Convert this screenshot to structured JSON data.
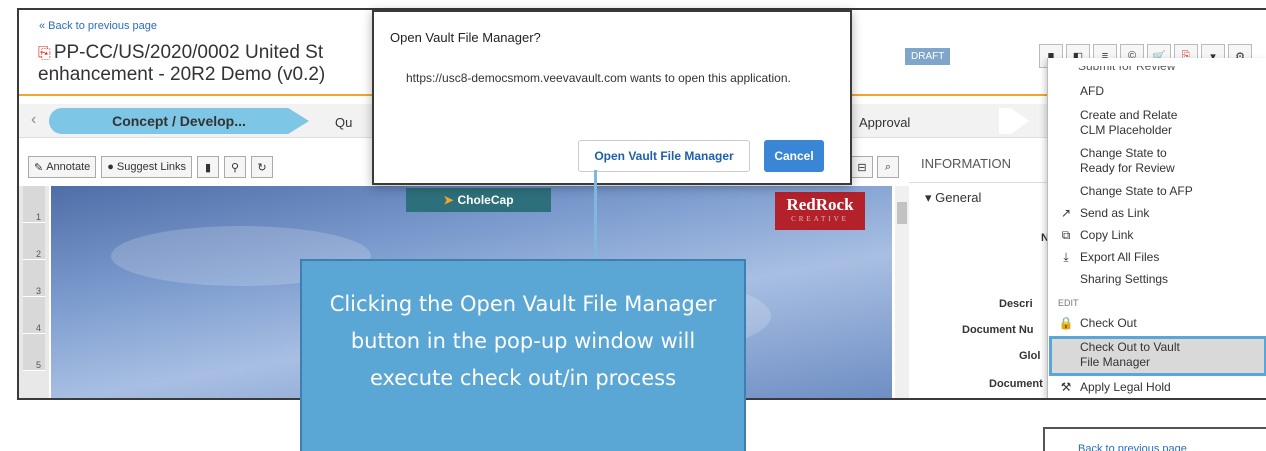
{
  "page": {
    "back_link": "« Back to previous page",
    "title_line1": "PP-CC/US/2020/0002 United St",
    "title_line2": "enhancement - 20R2 Demo (v0.2)",
    "status_badge": "DRAFT"
  },
  "lifecycle": {
    "active_step": "Concept / Develop...",
    "step2": "Qu",
    "step_approval": "Approval"
  },
  "view_toolbar": {
    "annotate": "Annotate",
    "suggest_links": "Suggest Links"
  },
  "info_panel": {
    "header": "INFORMATION",
    "general": "General",
    "labels": [
      "N",
      "Descri",
      "Document Nu",
      "Glol",
      "Document"
    ]
  },
  "document": {
    "page_numbers": [
      "1",
      "2",
      "3",
      "4",
      "5"
    ],
    "logo_left": "CholeCap",
    "logo_right": "RedRock",
    "logo_right_sub": "CREATIVE"
  },
  "dialog": {
    "title": "Open Vault File Manager?",
    "message": "https://usc8-democsmom.veevavault.com wants to open this application.",
    "open_button": "Open Vault File Manager",
    "cancel_button": "Cancel"
  },
  "callout": {
    "text": "Clicking the Open Vault File Manager button in the pop-up window will execute check out/in process"
  },
  "menu": {
    "cut_item": "Submit for Review",
    "items": [
      {
        "label": "AFD",
        "icon": ""
      },
      {
        "label": "Create and Relate CLM Placeholder",
        "icon": ""
      },
      {
        "label": "Change State to Ready for Review",
        "icon": ""
      },
      {
        "label": "Change State to AFP",
        "icon": ""
      },
      {
        "label": "Send as Link",
        "icon": "share-icon"
      },
      {
        "label": "Copy Link",
        "icon": "copy-icon"
      },
      {
        "label": "Export All Files",
        "icon": "download-icon"
      },
      {
        "label": "Sharing Settings",
        "icon": ""
      }
    ],
    "section_edit": "EDIT",
    "edit_items": [
      {
        "label": "Check Out",
        "icon": "lock-icon"
      },
      {
        "label": "Check Out to Vault File Manager",
        "icon": ""
      },
      {
        "label": "Apply Legal Hold",
        "icon": "gavel-icon"
      }
    ]
  },
  "mini_preview": {
    "text": "Back to previous page"
  },
  "colors": {
    "accent_orange": "#f3a530",
    "step_active": "#7ec6e5",
    "callout_bg": "#5aa6d4",
    "cancel_blue": "#3a86d6",
    "draft_badge": "#7fa5c8"
  }
}
